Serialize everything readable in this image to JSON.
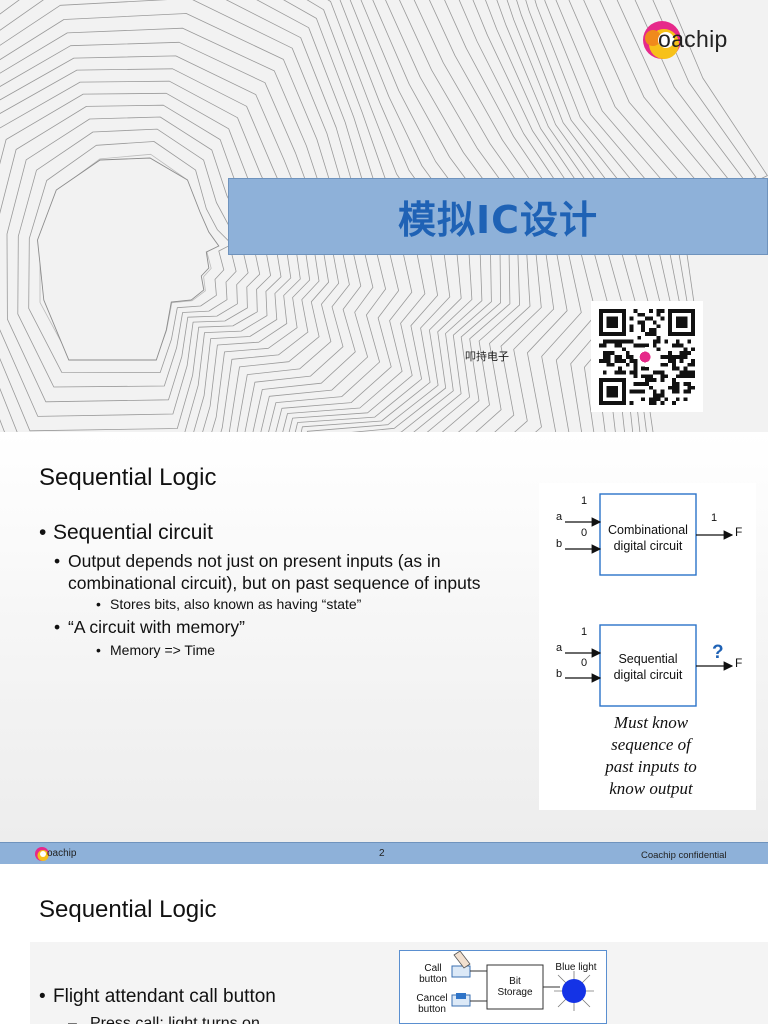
{
  "slide1": {
    "logo_text": "oachip",
    "title": "模拟IC设计",
    "company": "叩持电子"
  },
  "slide2": {
    "title": "Sequential Logic",
    "bullets": {
      "b1": "Sequential circuit",
      "b2": "Output depends not just on present inputs (as in combinational circuit), but on past sequence of inputs",
      "b3": "Stores bits, also known as having “state”",
      "b4": "“A circuit with memory”",
      "b5": "Memory => Time"
    },
    "diagram": {
      "comb_label_1": "Combinational",
      "comb_label_2": "digital circuit",
      "seq_label_1": "Sequential",
      "seq_label_2": "digital circuit",
      "input_a": "a",
      "input_b": "b",
      "val_1": "1",
      "val_0": "0",
      "out_1": "1",
      "output_f": "F",
      "question": "?",
      "note_1": "Must know",
      "note_2": "sequence of",
      "note_3": "past inputs to",
      "note_4": "know output"
    },
    "footer": {
      "brand": "oachip",
      "page": "2",
      "confidential": "Coachip confidential"
    }
  },
  "slide3": {
    "title": "Sequential Logic",
    "bullet1": "Flight attendant call button",
    "bullet2": "Press call: light turns on",
    "diagram": {
      "call_1": "Call",
      "call_2": "button",
      "cancel_1": "Cancel",
      "cancel_2": "button",
      "bit_1": "Bit",
      "bit_2": "Storage",
      "blue_light": "Blue light"
    }
  },
  "colors": {
    "title_bar": "#8eb1d9",
    "title_text": "#1f62b5",
    "accent_blue": "#1f62b5"
  }
}
